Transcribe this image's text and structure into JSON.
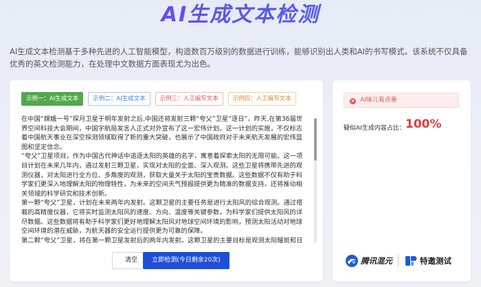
{
  "header": {
    "title": "AI生成文本检测"
  },
  "intro": "AI生成文本检测基于多种先进的人工智能模型，构造数百万级别的数据进行训练，能够识别出人类和AI的书写模式。该系统不仅具备优秀的英文检测能力，在处理中文数据方面表现尤为出色。",
  "tabs": [
    {
      "label": "示例一：AI生成文本",
      "color": "#52a84a"
    },
    {
      "label": "示例二：AI生成文本",
      "color": "#3c7fd6"
    },
    {
      "label": "示例三：人工编写文本",
      "color": "#e0554a"
    },
    {
      "label": "示例四：人工编写文本",
      "color": "#d9892a"
    }
  ],
  "input_text": [
    "在中国“嫦娥一号”探月卫星于明年发射之后,中国还将发射三颗“夸父”卫星“逐日”。昨天,在第36届世界空间科技大会期间，中国宇航局发言人正式对外宣布了这一宏伟计划。这一计划的实施，不仅标志着中国航天事业在深空探测领域取得了新的重大突破，也展示了中国政府对于未来航天发展的宏伟蓝图和坚定信念。",
    "“夸父”卫星项目，作为中国古代神话中追逐太阳的英雄的名字，寓意着探索太阳的无限可能。这一项目计划在未来几年内，通过发射三颗卫星，实现对太阳的全面、深入观测。这些卫星将携带先进的观测仪器，对太阳进行全方位、多角度的观测，获取大量关于太阳的宝贵数据。这些数据不仅有助于科学家们更深入地理解太阳的物理特性，为未来的空间天气预报提供更为精准的数据支持，还将推动相关领域的科学研究和技术创新。",
    "第一颗“夸父”卫星，计划在未来两年内发射。这颗卫星的主要任务是进行太阳风的综合观测。通过搭载的高精度仪器，它将实时监测太阳风的速度、方向、温度等关键参数，为科学家们提供太阳风的详尽数据。这些数据将有助于科学家们更好地理解太阳风对地球空间环境的影响，预测太阳活动对地球空间环境的潜在威胁，为航天器的安全运行提供更为可靠的保障。",
    "第二颗“夸父”卫星，将在第一颗卫星发射后的两年内发射。这颗卫星的主要目标是观测太阳耀斑和日冕物质抛射现象。通过搭载的先进观测设备，它将捕捉到太阳耀斑和日冕物质抛射的清晰图像和数据，揭示这些现象背后的物理机制。这些数据将有助于科学家们更好地预测太阳活动，降低太阳活动对地球空间环境和人类活动的影响，为地球空间环境的预测提供有力支持。"
  ],
  "buttons": {
    "clear": "清空",
    "detect": "立即检测(今日剩余20次)"
  },
  "result": {
    "alert": "AI味儿有点重",
    "ratio_label": "疑似AI生成内容占比：",
    "ratio_value": "100%"
  },
  "logos": {
    "hunyuan": "腾讯混元",
    "tejiao": "特邀测试"
  }
}
